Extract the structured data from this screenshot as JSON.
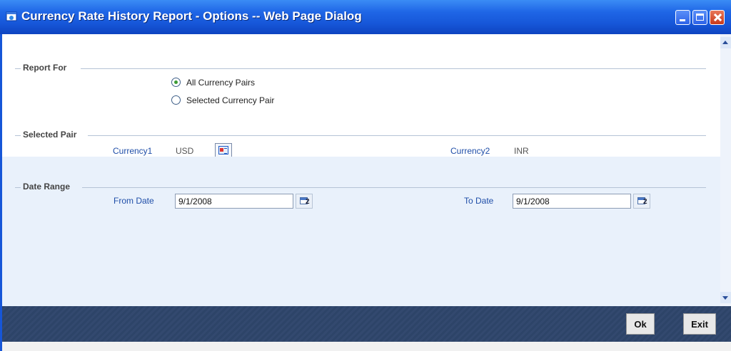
{
  "window": {
    "title": "Currency Rate History Report - Options -- Web Page Dialog"
  },
  "report_for": {
    "heading": "Report For",
    "options": [
      {
        "label": "All Currency Pairs",
        "checked": true
      },
      {
        "label": "Selected Currency Pair",
        "checked": false
      }
    ]
  },
  "selected_pair": {
    "heading": "Selected Pair",
    "currency1_label": "Currency1",
    "currency1_value": "USD",
    "currency2_label": "Currency2",
    "currency2_value": "INR"
  },
  "date_range": {
    "heading": "Date Range",
    "from_label": "From Date",
    "from_value": "9/1/2008",
    "to_label": "To Date",
    "to_value": "9/1/2008",
    "calendar_glyph": "2"
  },
  "footer": {
    "ok_label": "Ok",
    "exit_label": "Exit"
  },
  "icons": {
    "title": "ie-window-icon",
    "lookup": "lookup-list-icon",
    "calendar": "calendar-icon"
  },
  "colors": {
    "titlebar": "#1656d8",
    "field_label": "#1f4ea8",
    "lower_panel": "#e9f1fb",
    "footer": "#2d4468"
  }
}
